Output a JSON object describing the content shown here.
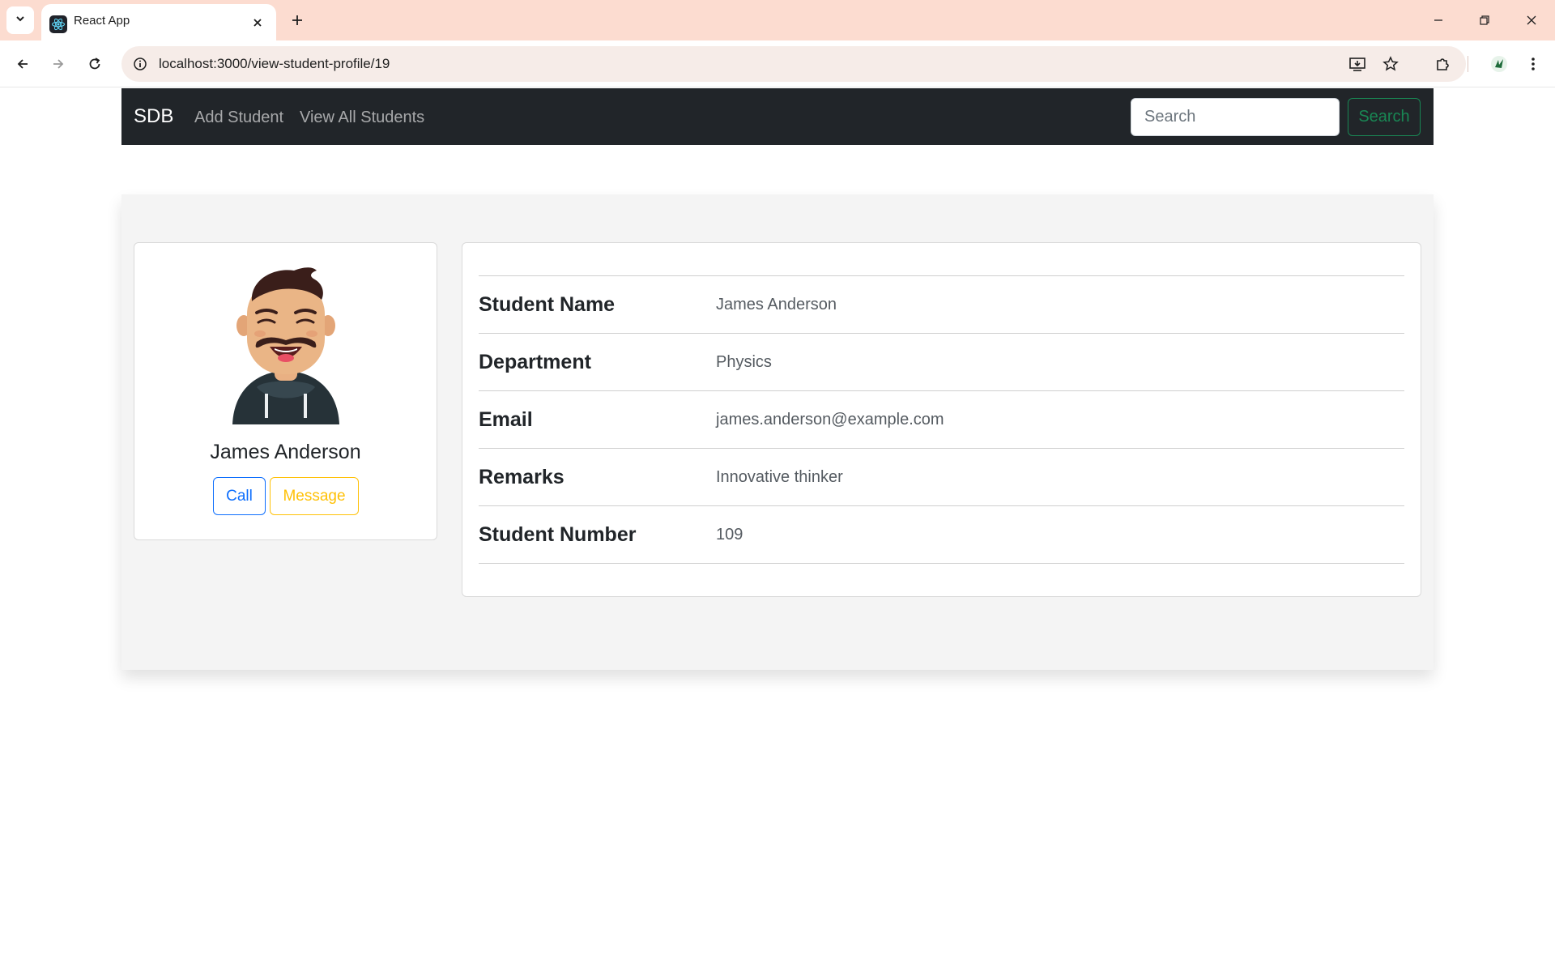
{
  "browser": {
    "tab_title": "React App",
    "url": "localhost:3000/view-student-profile/19"
  },
  "navbar": {
    "brand": "SDB",
    "links": [
      "Add Student",
      "View All Students"
    ],
    "search_placeholder": "Search",
    "search_button": "Search"
  },
  "profile": {
    "name": "James Anderson",
    "call_label": "Call",
    "message_label": "Message"
  },
  "details": [
    {
      "label": "Student Name",
      "value": "James Anderson"
    },
    {
      "label": "Department",
      "value": "Physics"
    },
    {
      "label": "Email",
      "value": "james.anderson@example.com"
    },
    {
      "label": "Remarks",
      "value": "Innovative thinker"
    },
    {
      "label": "Student Number",
      "value": "109"
    }
  ],
  "colors": {
    "navbar_bg": "#212529",
    "search_button": "#198754",
    "call_button": "#0d6efd",
    "message_button": "#ffc107",
    "section_bg": "#f4f4f4",
    "tabstrip_bg": "#fcdcd0"
  }
}
